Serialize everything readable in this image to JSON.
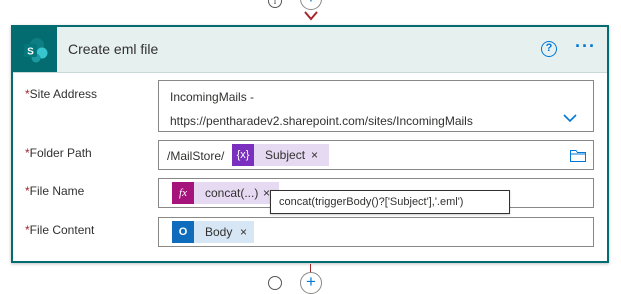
{
  "connector": {
    "info_icon": "info-icon",
    "add_icon": "plus-icon",
    "add_symbol": "+"
  },
  "card": {
    "title": "Create eml file",
    "help_symbol": "?",
    "more_symbol": "···",
    "accent_color": "#036c70"
  },
  "fields": {
    "site_address": {
      "required": "*",
      "label": "Site Address",
      "line1": "IncomingMails -",
      "line2": "https://pentharadev2.sharepoint.com/sites/IncomingMails"
    },
    "folder_path": {
      "required": "*",
      "label": "Folder Path",
      "prefix": "/MailStore/",
      "token_label": "Subject",
      "token_icon_text": "{x}",
      "token_remove": "×"
    },
    "file_name": {
      "required": "*",
      "label": "File Name",
      "token_label": "concat(...)",
      "token_icon_text": "fx",
      "token_remove": "×"
    },
    "file_content": {
      "required": "*",
      "label": "File Content",
      "token_label": "Body",
      "token_icon_text": "O",
      "token_remove": "×"
    }
  },
  "tooltip": {
    "text": "concat(triggerBody()?['Subject'],'.eml')"
  }
}
